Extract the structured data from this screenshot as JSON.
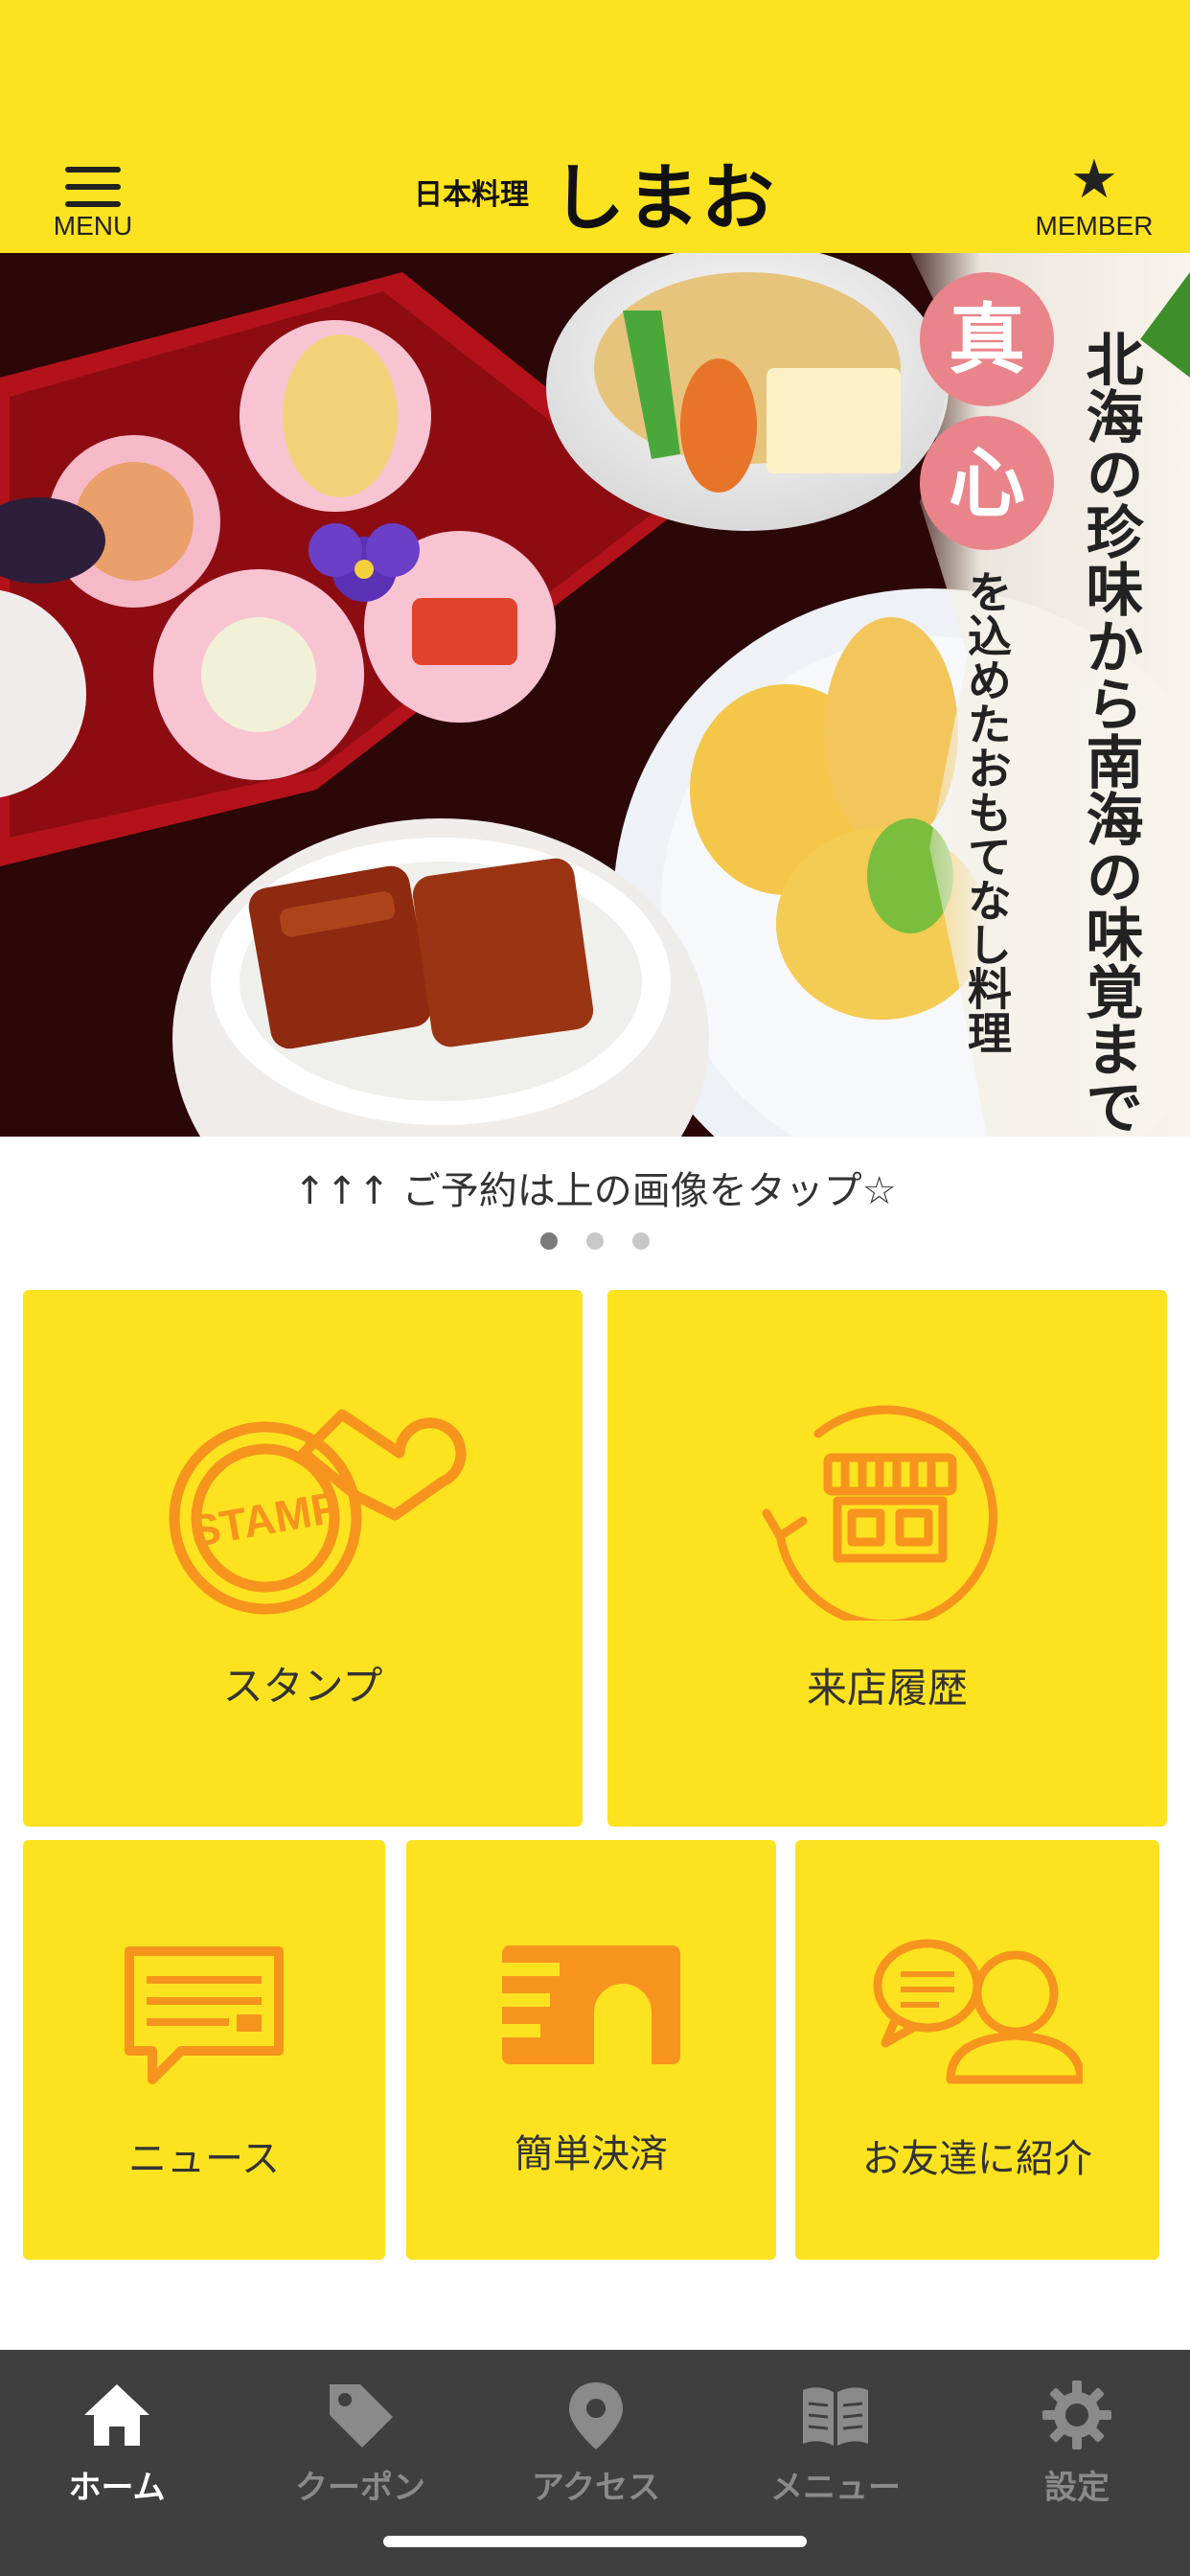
{
  "header": {
    "menu_label": "MENU",
    "member_label": "MEMBER",
    "logo_sub": "日本料理",
    "logo_main": "しまお"
  },
  "hero": {
    "banner_highlight": [
      "真",
      "心"
    ],
    "banner_col1": "北海の珍味から南海の味覚まで",
    "banner_col2": "を込めたおもてなし料理",
    "caption": "↑↑↑ ご予約は上の画像をタップ☆",
    "slide_count": 3,
    "active_slide": 1
  },
  "tiles": {
    "stamp": {
      "label": "スタンプ",
      "icon_text": "STAMP"
    },
    "visit_history": {
      "label": "来店履歴"
    },
    "news": {
      "label": "ニュース"
    },
    "payment": {
      "label": "簡単決済"
    },
    "refer": {
      "label": "お友達に紹介"
    }
  },
  "tabbar": {
    "home": "ホーム",
    "coupon": "クーポン",
    "access": "アクセス",
    "menu": "メニュー",
    "settings": "設定",
    "active": "home"
  },
  "colors": {
    "brand_yellow": "#fde21f",
    "icon_orange": "#f6941d",
    "tabbar_bg": "#3f3f3f"
  }
}
